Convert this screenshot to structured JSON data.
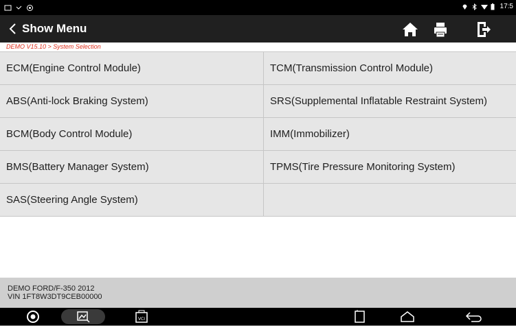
{
  "status_bar": {
    "time": "17:5",
    "icons": [
      "notification-icon",
      "usb-icon",
      "settings-icon",
      "location-icon",
      "bluetooth-icon",
      "wifi-icon",
      "battery-icon"
    ]
  },
  "header": {
    "title": "Show Menu",
    "back_icon": "chevron-left-icon",
    "actions": [
      "home-icon",
      "print-icon",
      "exit-icon"
    ]
  },
  "breadcrumb": "DEMO V15.10 > System Selection",
  "systems": [
    "ECM(Engine Control Module)",
    "TCM(Transmission Control Module)",
    "ABS(Anti-lock Braking System)",
    "SRS(Supplemental Inflatable Restraint System)",
    "BCM(Body Control Module)",
    "IMM(Immobilizer)",
    "BMS(Battery Manager System)",
    "TPMS(Tire Pressure Monitoring System)",
    "SAS(Steering Angle System)",
    ""
  ],
  "vehicle": {
    "model": "DEMO FORD/F-350 2012",
    "vin": "VIN 1FT8W3DT9CEB00000"
  },
  "nav_bar": {
    "icons": [
      "app-home-icon",
      "screenshot-icon",
      "vci-icon",
      "recent-apps-icon",
      "android-home-icon",
      "android-back-icon"
    ],
    "vci_label": "VCI"
  },
  "colors": {
    "toolbar": "#202020",
    "breadcrumb_text": "#e0301e",
    "cell_bg": "#e6e6e6",
    "info_bg": "#cfcfcf"
  }
}
